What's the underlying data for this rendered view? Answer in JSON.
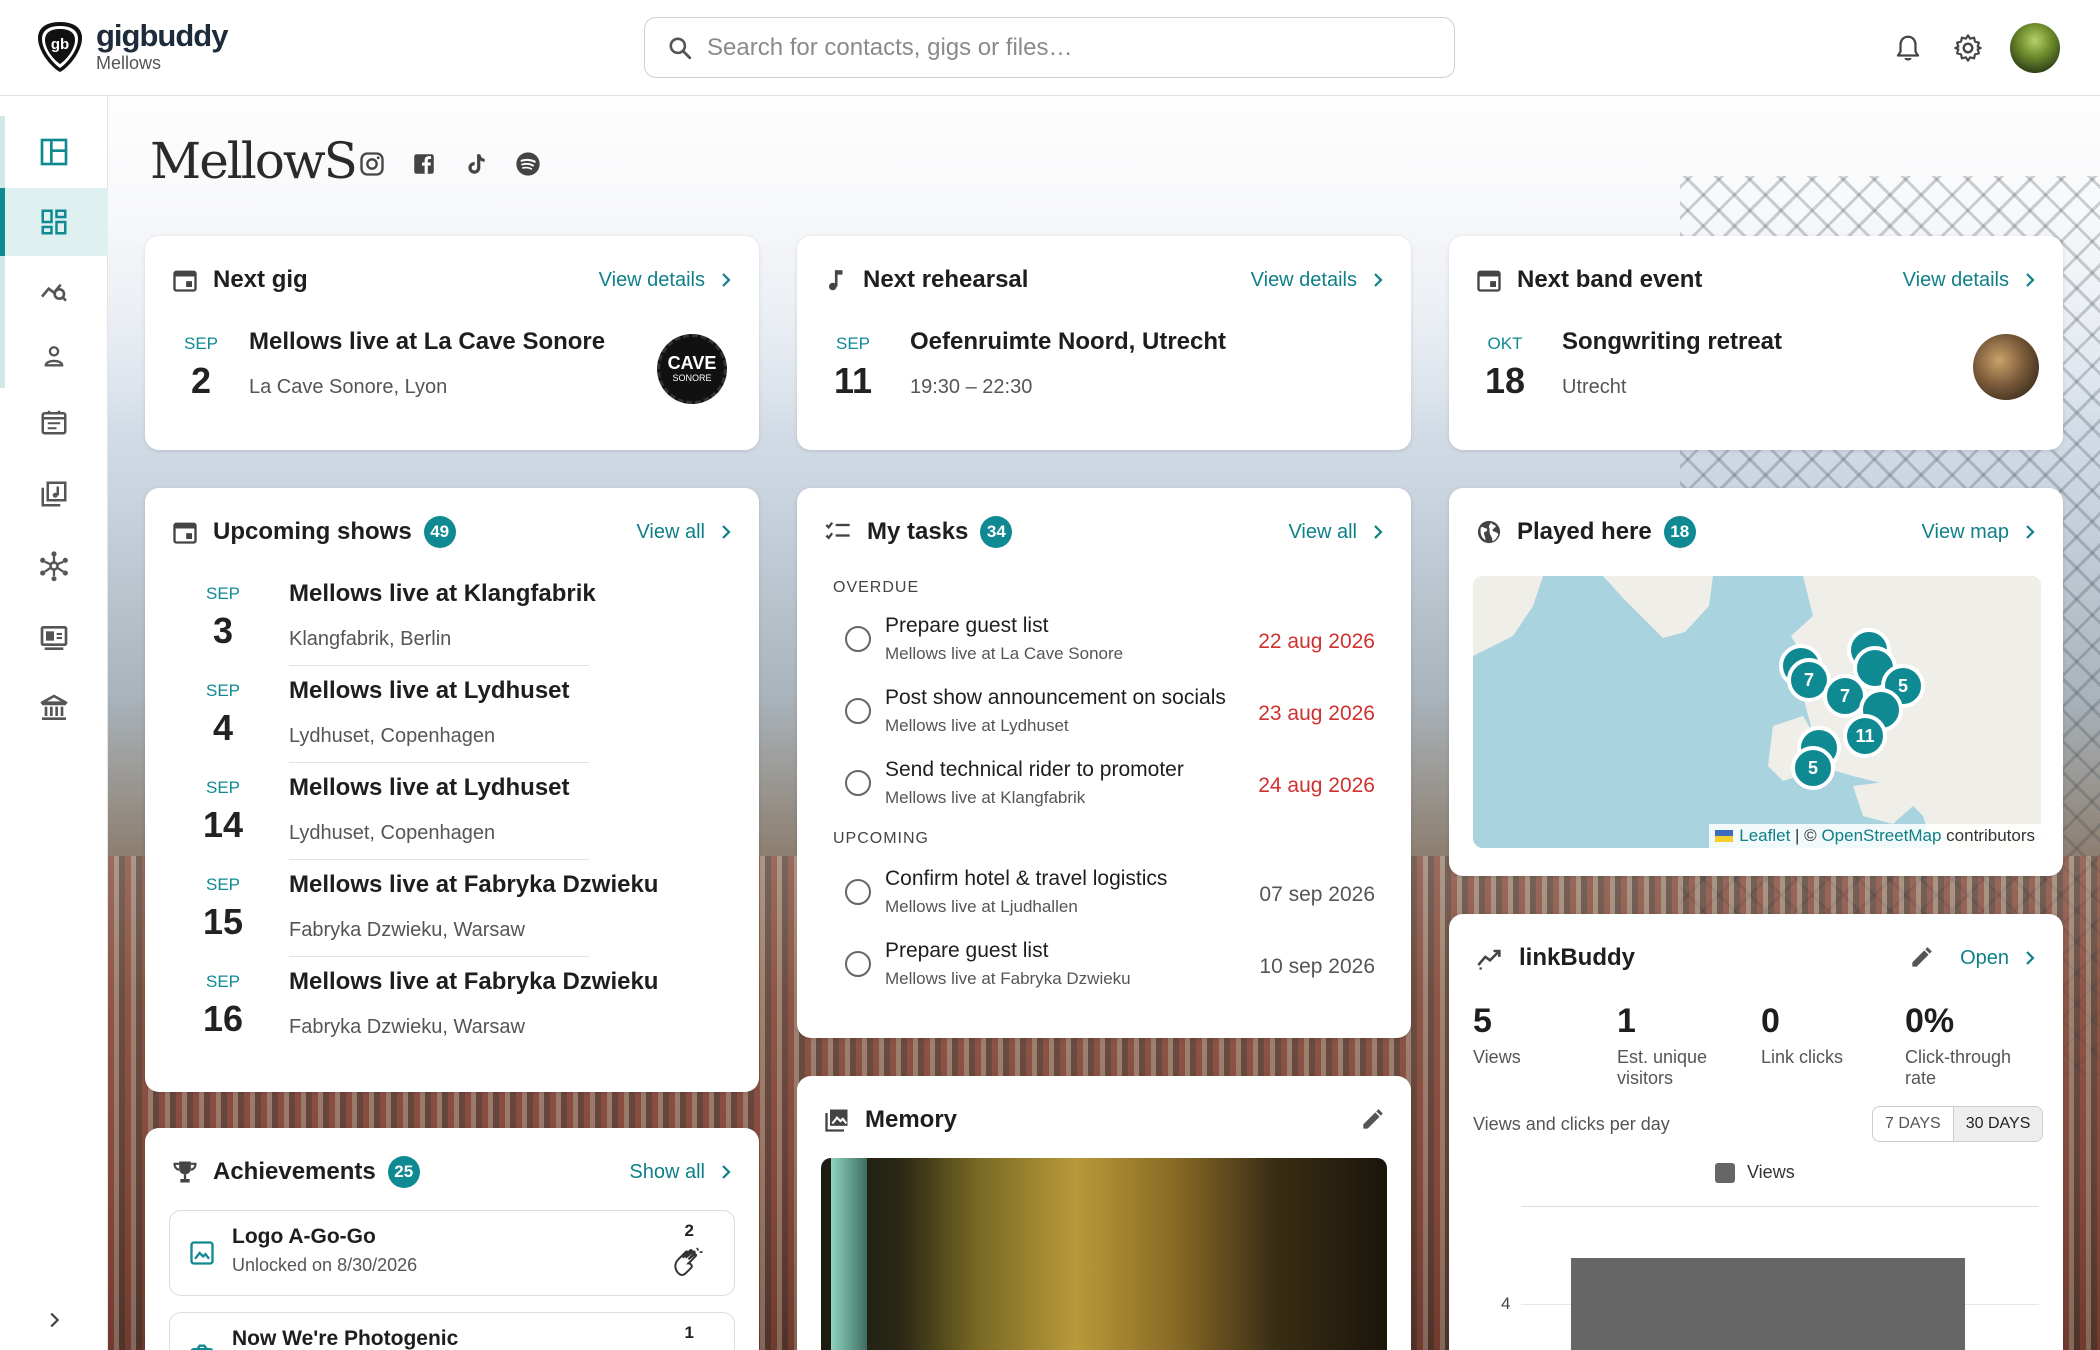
{
  "app": {
    "brand": "gigbuddy",
    "band_sub": "Mellows",
    "search_placeholder": "Search for contacts, gigs or files…"
  },
  "band": {
    "logo_text": "MellowS",
    "socials": [
      "instagram-icon",
      "facebook-icon",
      "tiktok-icon",
      "spotify-icon"
    ]
  },
  "sidebar": {
    "items": [
      "layout-icon",
      "dashboard-icon",
      "analytics-icon",
      "person-icon",
      "calendar-icon",
      "music-library-icon",
      "network-icon",
      "media-icon",
      "institution-icon"
    ],
    "selected": "dashboard-icon",
    "collapse_icon": "chevron-right-icon"
  },
  "next_gig": {
    "title": "Next gig",
    "link": "View details",
    "month": "SEP",
    "day": "2",
    "name": "Mellows live at La Cave Sonore",
    "location": "La Cave Sonore, Lyon",
    "thumb_text": "CAVE",
    "thumb_sub": "SONORE"
  },
  "next_rehearsal": {
    "title": "Next rehearsal",
    "link": "View details",
    "month": "SEP",
    "day": "11",
    "name": "Oefenruimte Noord, Utrecht",
    "time": "19:30 – 22:30"
  },
  "next_event": {
    "title": "Next band event",
    "link": "View details",
    "month": "OKT",
    "day": "18",
    "name": "Songwriting retreat",
    "location": "Utrecht"
  },
  "upcoming_shows": {
    "title": "Upcoming shows",
    "count": "49",
    "link": "View all",
    "items": [
      {
        "month": "SEP",
        "day": "3",
        "name": "Mellows live at Klangfabrik",
        "location": "Klangfabrik, Berlin"
      },
      {
        "month": "SEP",
        "day": "4",
        "name": "Mellows live at Lydhuset",
        "location": "Lydhuset, Copenhagen"
      },
      {
        "month": "SEP",
        "day": "14",
        "name": "Mellows live at Lydhuset",
        "location": "Lydhuset, Copenhagen"
      },
      {
        "month": "SEP",
        "day": "15",
        "name": "Mellows live at Fabryka Dzwieku",
        "location": "Fabryka Dzwieku, Warsaw"
      },
      {
        "month": "SEP",
        "day": "16",
        "name": "Mellows live at Fabryka Dzwieku",
        "location": "Fabryka Dzwieku, Warsaw"
      }
    ]
  },
  "tasks": {
    "title": "My tasks",
    "count": "34",
    "link": "View all",
    "overdue_label": "OVERDUE",
    "upcoming_label": "UPCOMING",
    "overdue": [
      {
        "title": "Prepare guest list",
        "gig": "Mellows live at La Cave Sonore",
        "date": "22 aug 2026"
      },
      {
        "title": "Post show announcement on socials",
        "gig": "Mellows live at Lydhuset",
        "date": "23 aug 2026"
      },
      {
        "title": "Send technical rider to promoter",
        "gig": "Mellows live at Klangfabrik",
        "date": "24 aug 2026"
      }
    ],
    "upcoming": [
      {
        "title": "Confirm hotel & travel logistics",
        "gig": "Mellows live at Ljudhallen",
        "date": "07 sep 2026"
      },
      {
        "title": "Prepare guest list",
        "gig": "Mellows live at Fabryka Dzwieku",
        "date": "10 sep 2026"
      }
    ]
  },
  "played_here": {
    "title": "Played here",
    "count": "18",
    "link": "View map",
    "clusters": [
      "7",
      "7",
      "5",
      "11",
      "5"
    ],
    "attribution": {
      "leaflet": "Leaflet",
      "sep": " | © ",
      "osm": "OpenStreetMap",
      "tail": " contributors"
    }
  },
  "linkbuddy": {
    "title": "linkBuddy",
    "link": "Open",
    "stats": [
      {
        "value": "5",
        "label": "Views"
      },
      {
        "value": "1",
        "label": "Est. unique visitors"
      },
      {
        "value": "0",
        "label": "Link clicks"
      },
      {
        "value": "0%",
        "label": "Click-through rate"
      }
    ],
    "chart_caption": "Views and clicks per day",
    "range_options": [
      "7 DAYS",
      "30 DAYS"
    ],
    "range_selected": "30 DAYS",
    "legend": "Views",
    "y_tick": "4"
  },
  "memory": {
    "title": "Memory"
  },
  "achievements": {
    "title": "Achievements",
    "count": "25",
    "link": "Show all",
    "items": [
      {
        "title": "Logo A-Go-Go",
        "sub": "Unlocked on 8/30/2026",
        "count": "2"
      },
      {
        "title": "Now We're Photogenic",
        "sub": "",
        "count": "1"
      }
    ]
  },
  "colors": {
    "accent": "#0f8a93",
    "overdue": "#d0312d"
  }
}
